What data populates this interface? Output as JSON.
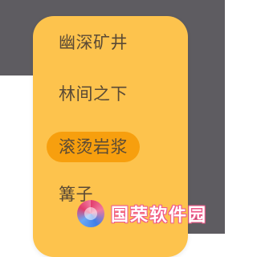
{
  "menu": {
    "items": [
      {
        "label": "幽深矿井",
        "selected": false
      },
      {
        "label": "林间之下",
        "selected": false
      },
      {
        "label": "滚烫岩浆",
        "selected": true
      },
      {
        "label": "篝子",
        "selected": false
      }
    ],
    "colors": {
      "panel": "#fdc34d",
      "selected_pill": "#f79f0e",
      "text": "#5a4a35",
      "overlay": "#5e5c61"
    }
  },
  "watermark": {
    "text": "国荣软件园",
    "logo_icon": "globe-logo-icon"
  }
}
